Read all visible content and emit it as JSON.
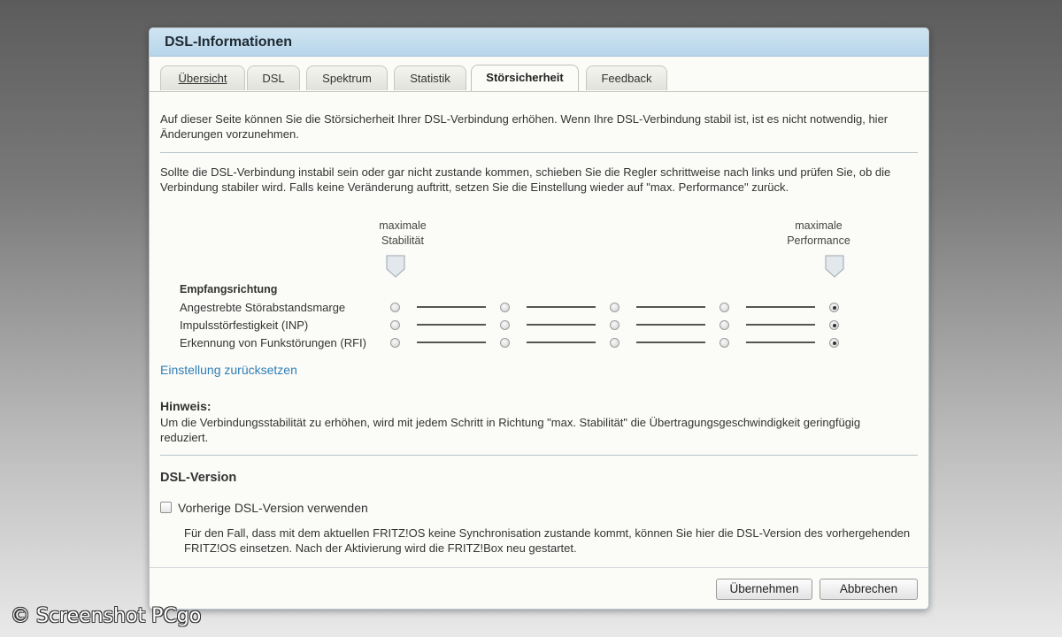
{
  "window": {
    "title": "DSL-Informationen"
  },
  "tabs": [
    {
      "label": "Übersicht"
    },
    {
      "label": "DSL"
    },
    {
      "label": "Spektrum"
    },
    {
      "label": "Statistik"
    },
    {
      "label": "Störsicherheit",
      "active": true
    },
    {
      "label": "Feedback"
    }
  ],
  "intro": "Auf dieser Seite können Sie die Störsicherheit Ihrer DSL-Verbindung erhöhen. Wenn Ihre DSL-Verbindung stabil ist, ist es nicht notwendig, hier Änderungen vorzunehmen.",
  "instructions": "Sollte die DSL-Verbindung instabil sein oder gar nicht zustande kommen, schieben Sie die Regler schrittweise nach links und prüfen Sie, ob die Verbindung stabiler wird. Falls keine Veränderung auftritt, setzen Sie die Einstellung wieder auf \"max. Performance\" zurück.",
  "slider_header": {
    "left_line1": "maximale",
    "left_line2": "Stabilität",
    "right_line1": "maximale",
    "right_line2": "Performance"
  },
  "group_title": "Empfangsrichtung",
  "rows": [
    {
      "label": "Angestrebte Störabstandsmarge",
      "selected_step": 5,
      "steps": 5
    },
    {
      "label": "Impulsstörfestigkeit (INP)",
      "selected_step": 5,
      "steps": 5
    },
    {
      "label": "Erkennung von Funkstörungen (RFI)",
      "selected_step": 5,
      "steps": 5
    }
  ],
  "reset_link": "Einstellung zurücksetzen",
  "hint": {
    "title": "Hinweis:",
    "text": "Um die Verbindungsstabilität zu erhöhen, wird mit jedem Schritt in Richtung \"max. Stabilität\" die Übertragungsgeschwindigkeit geringfügig reduziert."
  },
  "dsl_version": {
    "title": "DSL-Version",
    "checkbox_label": "Vorherige DSL-Version verwenden",
    "checked": false,
    "description": "Für den Fall, dass mit dem aktuellen FRITZ!OS keine Synchronisation zustande kommt, können Sie hier die DSL-Version des vorhergehenden FRITZ!OS einsetzen. Nach der Aktivierung wird die FRITZ!Box neu gestartet."
  },
  "buttons": {
    "apply": "Übernehmen",
    "cancel": "Abbrechen"
  },
  "watermark": "© Screenshot PCgo"
}
